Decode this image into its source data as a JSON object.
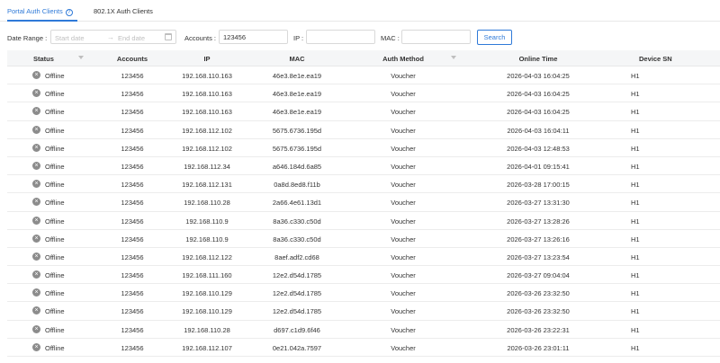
{
  "tabs": [
    {
      "label": "Portal Auth Clients",
      "active": true
    },
    {
      "label": "802.1X Auth Clients",
      "active": false
    }
  ],
  "icons": {
    "help": "help-circle-icon",
    "calendar": "calendar-icon",
    "status": "offline-x-icon",
    "filter": "filter-icon"
  },
  "colors": {
    "accent": "#2f7ad8",
    "offline_icon": "#8c8c8c"
  },
  "filters": {
    "date_range_label": "Date Range :",
    "start_placeholder": "Start date",
    "end_placeholder": "End date",
    "accounts_label": "Accounts :",
    "accounts_value": "123456",
    "ip_label": "IP :",
    "ip_value": "",
    "mac_label": "MAC :",
    "mac_value": "",
    "search_label": "Search"
  },
  "table": {
    "headers": {
      "status": "Status",
      "accounts": "Accounts",
      "ip": "IP",
      "mac": "MAC",
      "auth_method": "Auth Method",
      "online_time": "Online Time",
      "device_sn": "Device SN"
    },
    "rows": [
      {
        "status": "Offline",
        "accounts": "123456",
        "ip": "192.168.110.163",
        "mac": "46e3.8e1e.ea19",
        "auth": "Voucher",
        "time": "2026-04-03 16:04:25",
        "sn": "H1"
      },
      {
        "status": "Offline",
        "accounts": "123456",
        "ip": "192.168.110.163",
        "mac": "46e3.8e1e.ea19",
        "auth": "Voucher",
        "time": "2026-04-03 16:04:25",
        "sn": "H1"
      },
      {
        "status": "Offline",
        "accounts": "123456",
        "ip": "192.168.110.163",
        "mac": "46e3.8e1e.ea19",
        "auth": "Voucher",
        "time": "2026-04-03 16:04:25",
        "sn": "H1"
      },
      {
        "status": "Offline",
        "accounts": "123456",
        "ip": "192.168.112.102",
        "mac": "5675.6736.195d",
        "auth": "Voucher",
        "time": "2026-04-03 16:04:11",
        "sn": "H1"
      },
      {
        "status": "Offline",
        "accounts": "123456",
        "ip": "192.168.112.102",
        "mac": "5675.6736.195d",
        "auth": "Voucher",
        "time": "2026-04-03 12:48:53",
        "sn": "H1"
      },
      {
        "status": "Offline",
        "accounts": "123456",
        "ip": "192.168.112.34",
        "mac": "a646.184d.6a85",
        "auth": "Voucher",
        "time": "2026-04-01 09:15:41",
        "sn": "H1"
      },
      {
        "status": "Offline",
        "accounts": "123456",
        "ip": "192.168.112.131",
        "mac": "0a8d.8ed8.f11b",
        "auth": "Voucher",
        "time": "2026-03-28 17:00:15",
        "sn": "H1"
      },
      {
        "status": "Offline",
        "accounts": "123456",
        "ip": "192.168.110.28",
        "mac": "2a66.4e61.13d1",
        "auth": "Voucher",
        "time": "2026-03-27 13:31:30",
        "sn": "H1"
      },
      {
        "status": "Offline",
        "accounts": "123456",
        "ip": "192.168.110.9",
        "mac": "8a36.c330.c50d",
        "auth": "Voucher",
        "time": "2026-03-27 13:28:26",
        "sn": "H1"
      },
      {
        "status": "Offline",
        "accounts": "123456",
        "ip": "192.168.110.9",
        "mac": "8a36.c330.c50d",
        "auth": "Voucher",
        "time": "2026-03-27 13:26:16",
        "sn": "H1"
      },
      {
        "status": "Offline",
        "accounts": "123456",
        "ip": "192.168.112.122",
        "mac": "8aef.adf2.cd68",
        "auth": "Voucher",
        "time": "2026-03-27 13:23:54",
        "sn": "H1"
      },
      {
        "status": "Offline",
        "accounts": "123456",
        "ip": "192.168.111.160",
        "mac": "12e2.d54d.1785",
        "auth": "Voucher",
        "time": "2026-03-27 09:04:04",
        "sn": "H1"
      },
      {
        "status": "Offline",
        "accounts": "123456",
        "ip": "192.168.110.129",
        "mac": "12e2.d54d.1785",
        "auth": "Voucher",
        "time": "2026-03-26 23:32:50",
        "sn": "H1"
      },
      {
        "status": "Offline",
        "accounts": "123456",
        "ip": "192.168.110.129",
        "mac": "12e2.d54d.1785",
        "auth": "Voucher",
        "time": "2026-03-26 23:32:50",
        "sn": "H1"
      },
      {
        "status": "Offline",
        "accounts": "123456",
        "ip": "192.168.110.28",
        "mac": "d697.c1d9.6f46",
        "auth": "Voucher",
        "time": "2026-03-26 23:22:31",
        "sn": "H1"
      },
      {
        "status": "Offline",
        "accounts": "123456",
        "ip": "192.168.112.107",
        "mac": "0e21.042a.7597",
        "auth": "Voucher",
        "time": "2026-03-26 23:01:11",
        "sn": "H1"
      }
    ]
  }
}
